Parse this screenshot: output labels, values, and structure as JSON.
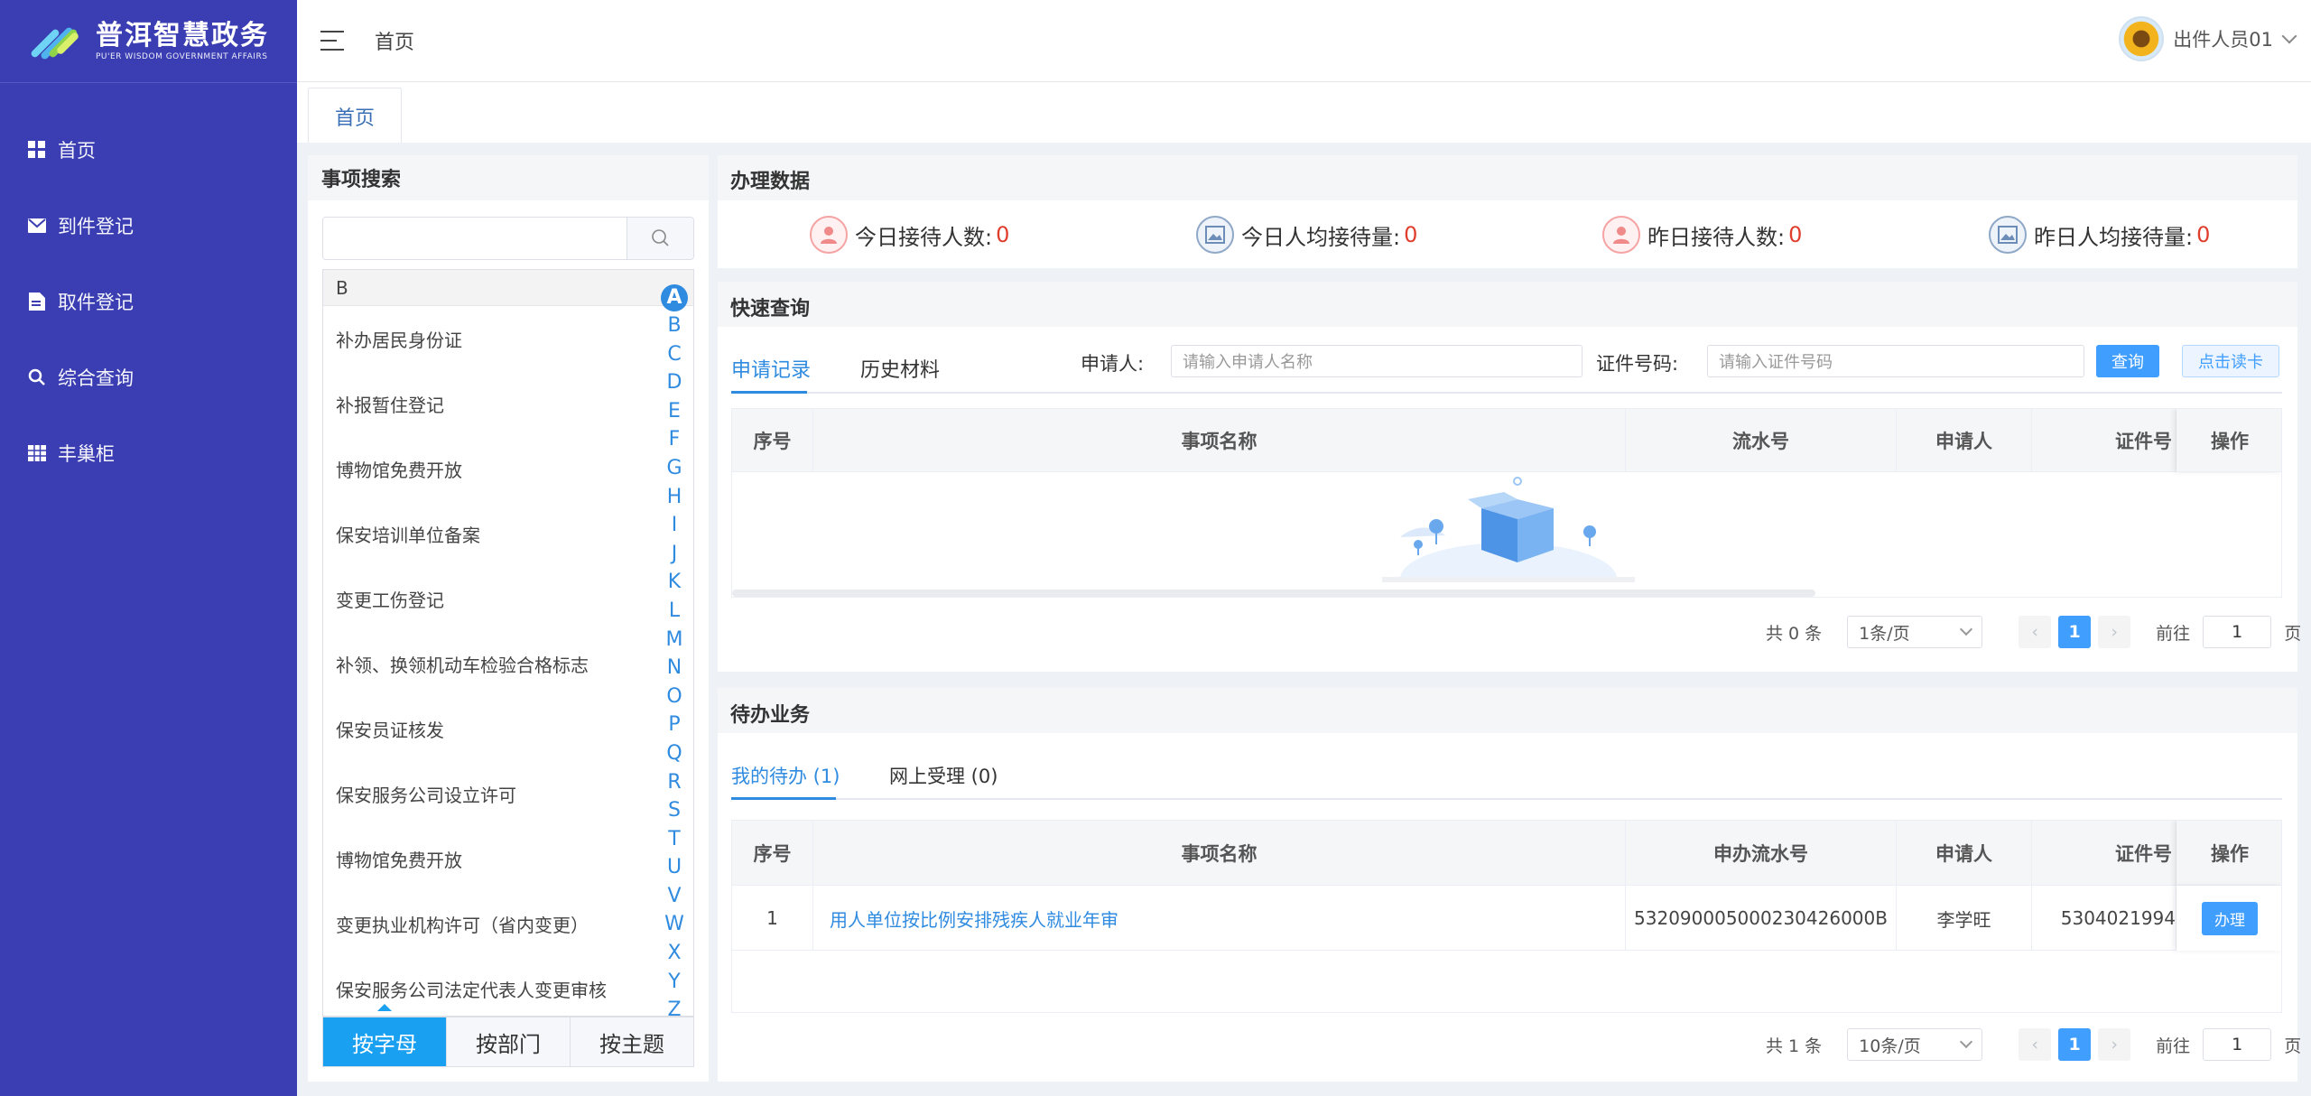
{
  "sidebar": {
    "logo_cn": "普洱智慧政务",
    "logo_en": "PU'ER WISDOM GOVERNMENT AFFAIRS",
    "items": [
      {
        "label": "首页",
        "icon": "grid-icon"
      },
      {
        "label": "到件登记",
        "icon": "mail-icon"
      },
      {
        "label": "取件登记",
        "icon": "document-icon"
      },
      {
        "label": "综合查询",
        "icon": "search-icon"
      },
      {
        "label": "丰巢柜",
        "icon": "cabinet-icon"
      }
    ]
  },
  "header": {
    "breadcrumb": "首页",
    "user_name": "出件人员01"
  },
  "tabs": {
    "home": "首页"
  },
  "search_panel": {
    "title": "事项搜索",
    "input_value": "",
    "group_letter": "B",
    "items": [
      "补办居民身份证",
      "补报暂住登记",
      "博物馆免费开放",
      "保安培训单位备案",
      "变更工伤登记",
      "补领、换领机动车检验合格标志",
      "保安员证核发",
      "保安服务公司设立许可",
      "博物馆免费开放",
      "变更执业机构许可（省内变更）",
      "保安服务公司法定代表人变更审核"
    ],
    "alphabet": [
      "A",
      "B",
      "C",
      "D",
      "E",
      "F",
      "G",
      "H",
      "I",
      "J",
      "K",
      "L",
      "M",
      "N",
      "O",
      "P",
      "Q",
      "R",
      "S",
      "T",
      "U",
      "V",
      "W",
      "X",
      "Y",
      "Z"
    ],
    "selected_letter": "A",
    "bottom_tabs": [
      "按字母",
      "按部门",
      "按主题"
    ]
  },
  "stats": {
    "title": "办理数据",
    "items": [
      {
        "label": "今日接待人数:",
        "value": "0"
      },
      {
        "label": "今日人均接待量:",
        "value": "0"
      },
      {
        "label": "昨日接待人数:",
        "value": "0"
      },
      {
        "label": "昨日人均接待量:",
        "value": "0"
      }
    ]
  },
  "quick_search": {
    "title": "快速查询",
    "tabs": [
      "申请记录",
      "历史材料"
    ],
    "applicant_label": "申请人:",
    "applicant_placeholder": "请输入申请人名称",
    "id_label": "证件号码:",
    "id_placeholder": "请输入证件号码",
    "query_button": "查询",
    "read_card_button": "点击读卡",
    "columns": [
      "序号",
      "事项名称",
      "流水号",
      "申请人",
      "证件号",
      "操作"
    ],
    "pager": {
      "total": "共 0 条",
      "page_size": "1条/页",
      "current": "1",
      "goto_label": "前往",
      "goto_value": "1",
      "page_unit": "页"
    }
  },
  "todo": {
    "title": "待办业务",
    "tabs": [
      "我的待办 (1)",
      "网上受理 (0)"
    ],
    "columns": [
      "序号",
      "事项名称",
      "申办流水号",
      "申请人",
      "证件号",
      "操作"
    ],
    "rows": [
      {
        "index": "1",
        "name": "用人单位按比例安排残疾人就业年审",
        "serial": "532090005000230426000B",
        "applicant": "李学旺",
        "id_no": "5304021994",
        "action": "办理"
      }
    ],
    "pager": {
      "total": "共 1 条",
      "page_size": "10条/页",
      "current": "1",
      "goto_label": "前往",
      "goto_value": "1",
      "page_unit": "页"
    }
  },
  "colors": {
    "sidebar": "#3b3eb3",
    "accent": "#409eff",
    "value_red": "#e03e2d"
  }
}
